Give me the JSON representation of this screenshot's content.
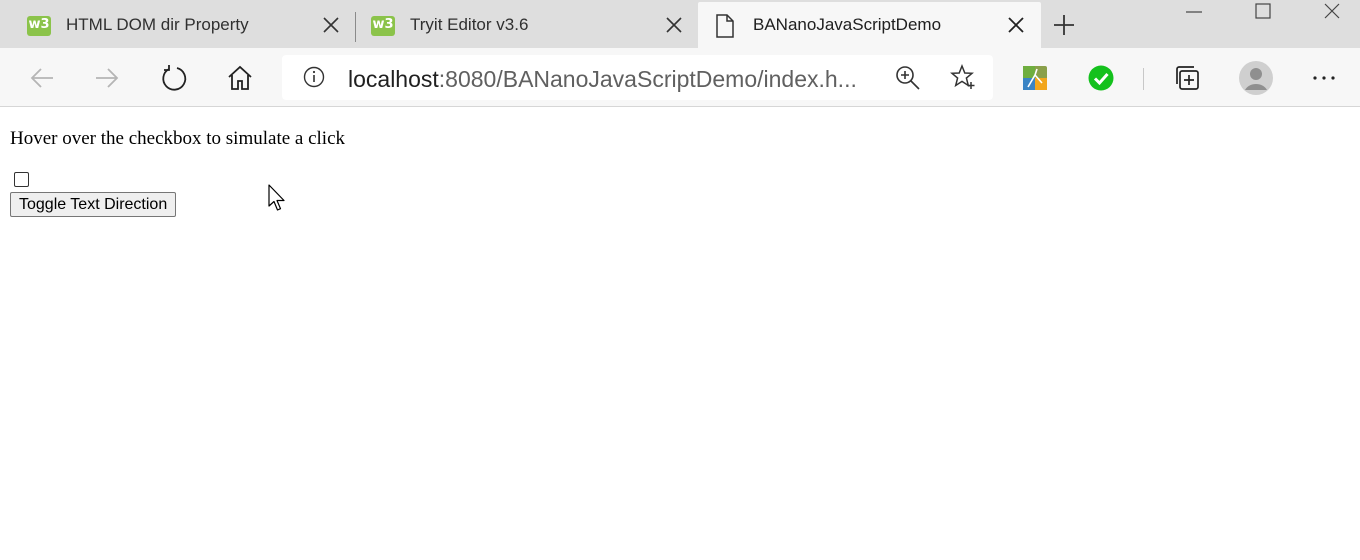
{
  "browser": {
    "tabs": [
      {
        "title": "HTML DOM dir Property",
        "favicon": "w3schools-icon",
        "active": false
      },
      {
        "title": "Tryit Editor v3.6",
        "favicon": "w3schools-icon",
        "active": false
      },
      {
        "title": "BANanoJavaScriptDemo",
        "favicon": "page-icon",
        "active": true
      }
    ],
    "address": {
      "host": "localhost",
      "rest": ":8080/BANanoJavaScriptDemo/index.h..."
    },
    "favicon_badge_text": "w3",
    "colors": {
      "tabstrip": "#dedede",
      "toolbar": "#f7f7f7",
      "w3_green": "#8bc34a",
      "check_green": "#14c11d"
    }
  },
  "page": {
    "instruction_text": "Hover over the checkbox to simulate a click",
    "checkbox_checked": false,
    "toggle_button_label": "Toggle Text Direction"
  }
}
